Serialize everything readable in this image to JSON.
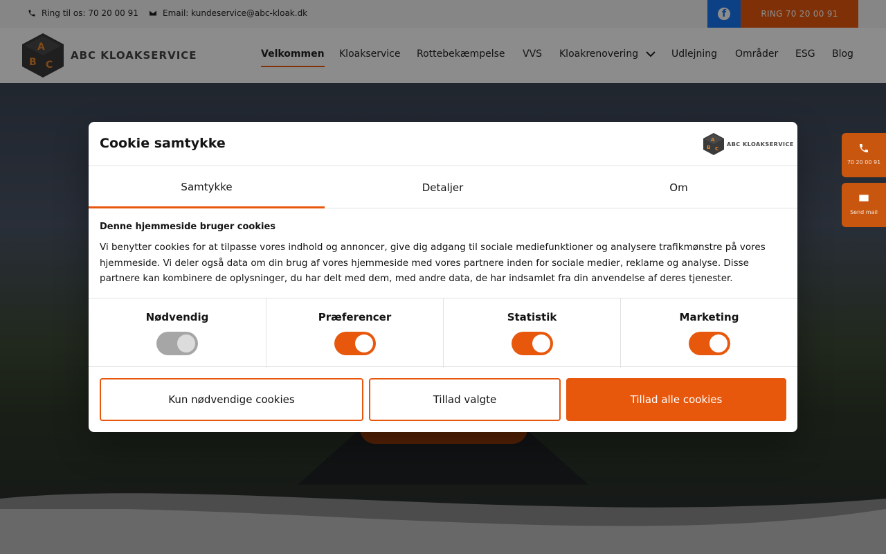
{
  "topbar": {
    "phone_text": "Ring til os: 70 20 00 91",
    "email_text": "Email: kundeservice@abc-kloak.dk",
    "facebook_glyph": "f",
    "ring_button": "RING 70 20 00 91"
  },
  "header": {
    "logo_text": "ABC KLOAKSERVICE",
    "logo_letters": [
      "A",
      "B",
      "C"
    ],
    "nav": [
      {
        "label": "Velkommen",
        "active": true
      },
      {
        "label": "Kloakservice"
      },
      {
        "label": "Rottebekæmpelse"
      },
      {
        "label": "VVS"
      },
      {
        "label": "Kloakrenovering",
        "dropdown": true
      },
      {
        "label": "Udlejning"
      },
      {
        "label": "Områder"
      },
      {
        "label": "ESG"
      },
      {
        "label": "Blog"
      }
    ]
  },
  "side": {
    "call_label": "70 20 00 91",
    "mail_label": "Send mail"
  },
  "cookie": {
    "title": "Cookie samtykke",
    "logo_text": "ABC KLOAKSERVICE",
    "tabs": [
      "Samtykke",
      "Detaljer",
      "Om"
    ],
    "heading": "Denne hjemmeside bruger cookies",
    "text": "Vi benytter cookies for at tilpasse vores indhold og annoncer, give dig adgang til sociale mediefunktioner og analysere trafikmønstre på vores hjemmeside. Vi deler også data om din brug af vores hjemmeside med vores partnere inden for sociale medier, reklame og analyse. Disse partnere kan kombinere de oplysninger, du har delt med dem, med andre data, de har indsamlet fra din anvendelse af deres tjenester.",
    "categories": [
      {
        "label": "Nødvendig",
        "on": true,
        "disabled": true
      },
      {
        "label": "Præferencer",
        "on": true
      },
      {
        "label": "Statistik",
        "on": true
      },
      {
        "label": "Marketing",
        "on": true
      }
    ],
    "buttons": {
      "necessary": "Kun nødvendige cookies",
      "selected": "Tillad valgte",
      "all": "Tillad alle cookies"
    }
  },
  "colors": {
    "accent": "#e8580c",
    "facebook": "#1877f2"
  },
  "icons": {
    "phone": "phone-icon",
    "email": "envelope-icon",
    "facebook": "facebook-icon",
    "dropdown": "chevron-down-icon"
  }
}
